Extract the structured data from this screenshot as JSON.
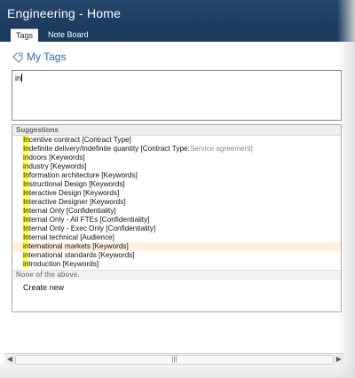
{
  "window": {
    "title": "Engineering - Home"
  },
  "tabs": [
    {
      "label": "Tags",
      "active": true
    },
    {
      "label": "Note Board",
      "active": false
    }
  ],
  "my_tags": {
    "label": "My Tags",
    "icon": "tag-icon"
  },
  "input": {
    "value": "in"
  },
  "suggestions": {
    "header": "Suggestions",
    "items": [
      {
        "match": "In",
        "rest": "centive contract [Contract Type]",
        "note": "",
        "active": false
      },
      {
        "match": "In",
        "rest": "definite delivery/Indefinite quantity [Contract Type:",
        "note": "Service agreement]",
        "active": false
      },
      {
        "match": "in",
        "rest": "doors [Keywords]",
        "note": "",
        "active": false
      },
      {
        "match": "in",
        "rest": "dustry [Keywords]",
        "note": "",
        "active": false
      },
      {
        "match": "In",
        "rest": "formation architecture [Keywords]",
        "note": "",
        "active": false
      },
      {
        "match": "In",
        "rest": "structional Design [Keywords]",
        "note": "",
        "active": false
      },
      {
        "match": "In",
        "rest": "teractive Design [Keywords]",
        "note": "",
        "active": false
      },
      {
        "match": "In",
        "rest": "teractive Designer [Keywords]",
        "note": "",
        "active": false
      },
      {
        "match": "In",
        "rest": "ternal Only [Confidentiality]",
        "note": "",
        "active": false
      },
      {
        "match": "In",
        "rest": "ternal Only - All FTEs [Confidentiality]",
        "note": "",
        "active": false
      },
      {
        "match": "In",
        "rest": "ternal Only - Exec Only [Confidentiality]",
        "note": "",
        "active": false
      },
      {
        "match": "In",
        "rest": "ternal technical [Audience]",
        "note": "",
        "active": false
      },
      {
        "match": "in",
        "rest": "ternational markets [Keywords]",
        "note": "",
        "active": true
      },
      {
        "match": "in",
        "rest": "ternational standards [Keywords]",
        "note": "",
        "active": false
      },
      {
        "match": "in",
        "rest": "troduction [Keywords]",
        "note": "",
        "active": false
      }
    ],
    "none_label": "None of the above.",
    "create_new": "Create new"
  },
  "scrollbar": {
    "left_arrow": "◀",
    "right_arrow": "▶",
    "grip": "|||"
  },
  "colors": {
    "titlebar": "#1c3a5e",
    "link": "#2a6ab0",
    "highlight": "#ffff33",
    "active_row": "#fff1dc"
  }
}
